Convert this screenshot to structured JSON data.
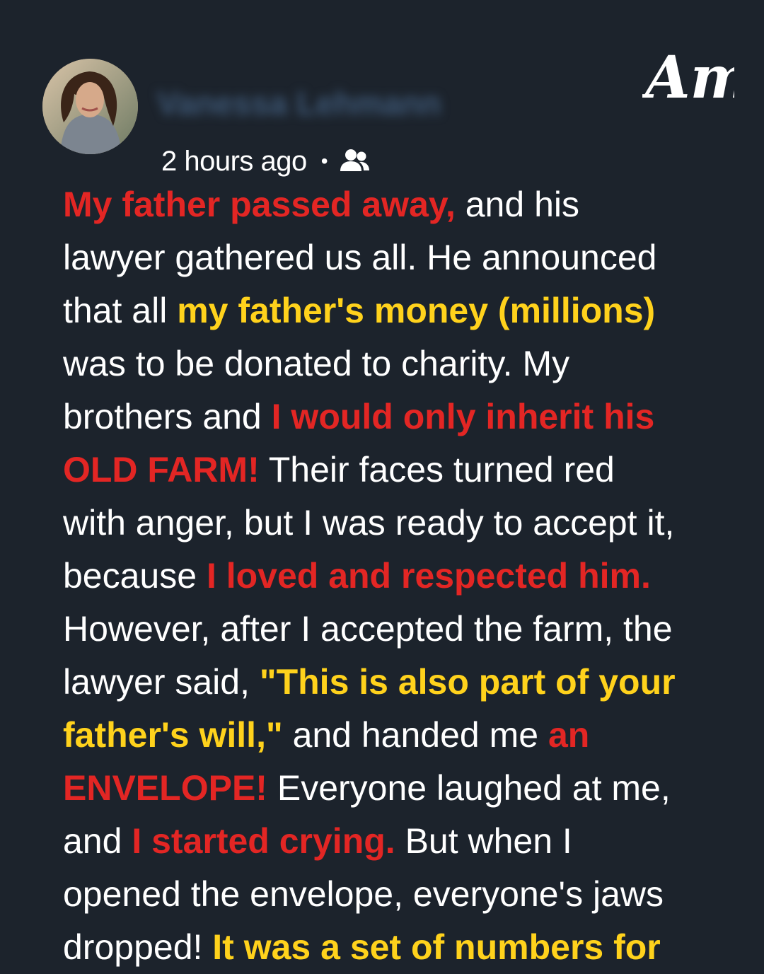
{
  "post": {
    "author_name": "Vanessa Lehmann",
    "timestamp": "2 hours ago",
    "separator": "•",
    "audience_icon": "friends-icon"
  },
  "brand": {
    "logo_text": "Am"
  },
  "colors": {
    "background": "#1c232c",
    "text": "#ffffff",
    "highlight_red": "#e32624",
    "highlight_yellow": "#ffd21c"
  },
  "story": {
    "l1": {
      "a": "My father passed away,",
      "b": " and his"
    },
    "l2": {
      "a": "lawyer gathered us all. He announced"
    },
    "l3": {
      "a": "that all ",
      "b": "my father's money (millions)"
    },
    "l4": {
      "a": "was to be donated to charity. My"
    },
    "l5": {
      "a": "brothers and ",
      "b": "I would only inherit his"
    },
    "l6": {
      "a": "OLD FARM!",
      "b": " Their faces turned red"
    },
    "l7": {
      "a": "with anger, but I was ready to accept it,"
    },
    "l8": {
      "a": "because ",
      "b": "I loved and respected him."
    },
    "l9": {
      "a": "However, after I accepted the farm, the"
    },
    "l10": {
      "a": "lawyer said, ",
      "b": "\"This is also part of your"
    },
    "l11": {
      "a": "father's will,\"",
      "b": " and handed me ",
      "c": "an"
    },
    "l12": {
      "a": "ENVELOPE!",
      "b": " Everyone laughed at me,"
    },
    "l13": {
      "a": "and ",
      "b": "I started crying.",
      "c": " But when I"
    },
    "l14": {
      "a": "opened the envelope, everyone's jaws"
    },
    "l15": {
      "a": "dropped! ",
      "b": "It was a set of numbers for"
    }
  }
}
